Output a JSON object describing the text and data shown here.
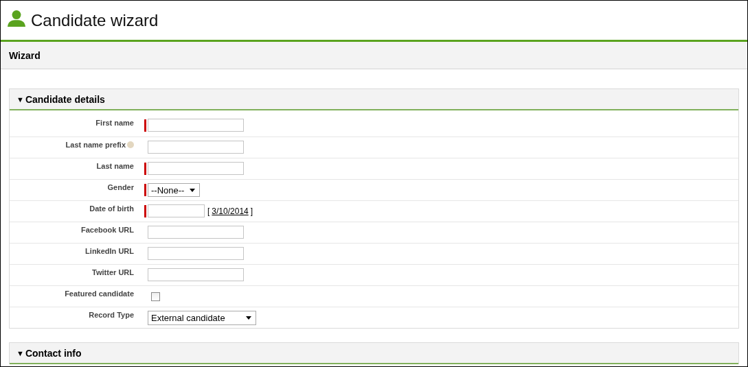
{
  "page": {
    "title": "Candidate wizard"
  },
  "wizard_bar": {
    "label": "Wizard"
  },
  "sections": [
    {
      "toggle": "▼",
      "title": "Candidate details",
      "expanded": true,
      "fields": [
        {
          "label": "First name",
          "kind": "text",
          "required": true,
          "help": false
        },
        {
          "label": "Last name prefix",
          "kind": "text",
          "required": false,
          "help": true
        },
        {
          "label": "Last name",
          "kind": "text",
          "required": true,
          "help": false
        },
        {
          "label": "Gender",
          "kind": "select",
          "required": true,
          "help": false,
          "value": "--None--"
        },
        {
          "label": "Date of birth",
          "kind": "date",
          "required": true,
          "help": false,
          "date_link": "3/10/2014",
          "bracket_open": "[",
          "bracket_close": "]"
        },
        {
          "label": "Facebook URL",
          "kind": "text",
          "required": false,
          "help": false
        },
        {
          "label": "LinkedIn URL",
          "kind": "text",
          "required": false,
          "help": false
        },
        {
          "label": "Twitter URL",
          "kind": "text",
          "required": false,
          "help": false
        },
        {
          "label": "Featured candidate",
          "kind": "checkbox",
          "required": false,
          "help": false,
          "checked": false
        },
        {
          "label": "Record Type",
          "kind": "select",
          "required": false,
          "help": false,
          "value": "External candidate"
        }
      ]
    },
    {
      "toggle": "▼",
      "title": "Contact info",
      "expanded": true
    }
  ]
}
